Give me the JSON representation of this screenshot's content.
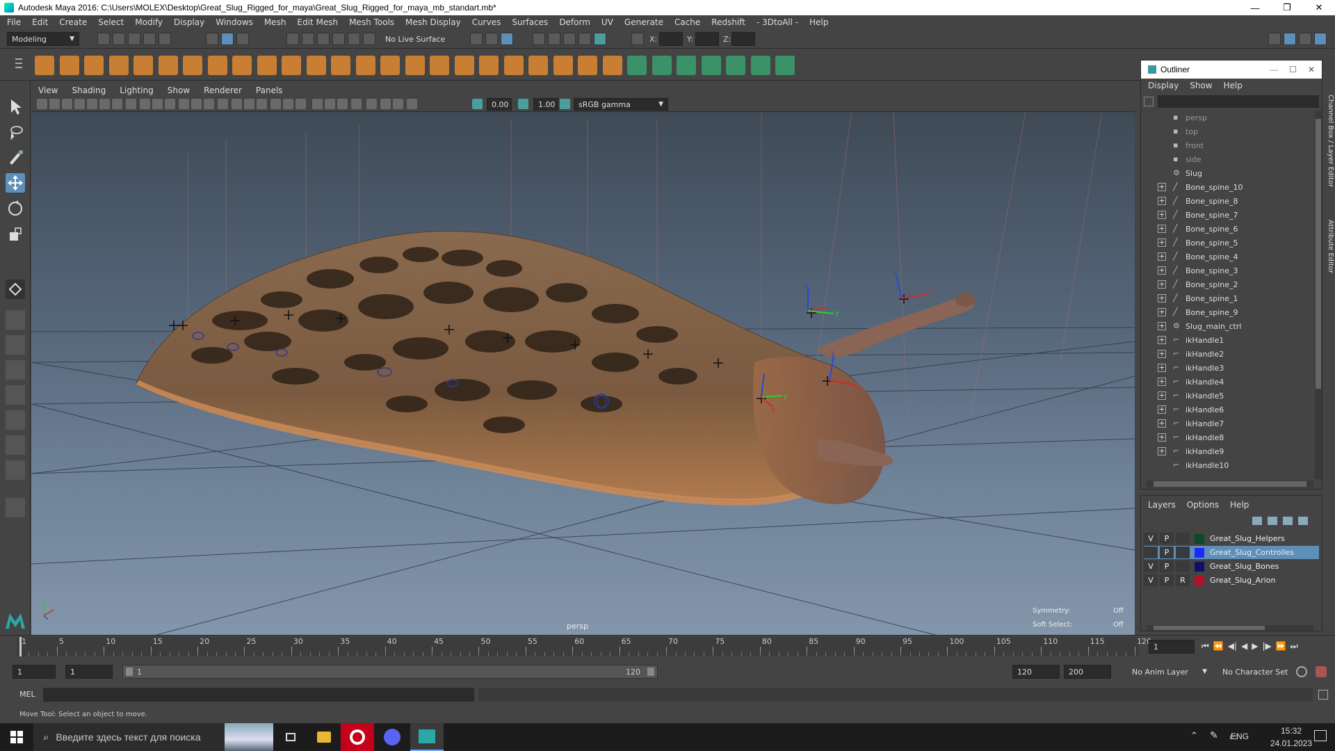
{
  "window": {
    "title": "Autodesk Maya 2016: C:\\Users\\MOLEX\\Desktop\\Great_Slug_Rigged_for_maya\\Great_Slug_Rigged_for_maya_mb_standart.mb*",
    "minimize": "—",
    "maximize": "❐",
    "close": "✕"
  },
  "menubar": [
    "File",
    "Edit",
    "Create",
    "Select",
    "Modify",
    "Display",
    "Windows",
    "Mesh",
    "Edit Mesh",
    "Mesh Tools",
    "Mesh Display",
    "Curves",
    "Surfaces",
    "Deform",
    "UV",
    "Generate",
    "Cache",
    "Redshift",
    "- 3DtoAll -",
    "Help"
  ],
  "statusline": {
    "mode": "Modeling",
    "live_surface": "No Live Surface",
    "x_label": "X:",
    "y_label": "Y:",
    "z_label": "Z:"
  },
  "viewport": {
    "menu": [
      "View",
      "Shading",
      "Lighting",
      "Show",
      "Renderer",
      "Panels"
    ],
    "exposure": "0.00",
    "gamma": "1.00",
    "color_space": "sRGB gamma",
    "camera_label": "persp",
    "symmetry_label": "Symmetry:",
    "symmetry_value": "Off",
    "soft_select_label": "Soft Select:",
    "soft_select_value": "Off"
  },
  "outliner": {
    "title": "Outliner",
    "menu": [
      "Display",
      "Show",
      "Help"
    ],
    "items": [
      {
        "label": "persp",
        "type": "camera",
        "expandable": false,
        "dim": true
      },
      {
        "label": "top",
        "type": "camera",
        "expandable": false,
        "dim": true
      },
      {
        "label": "front",
        "type": "camera",
        "expandable": false,
        "dim": true
      },
      {
        "label": "side",
        "type": "camera",
        "expandable": false,
        "dim": true
      },
      {
        "label": "Slug",
        "type": "group",
        "expandable": false,
        "dim": false
      },
      {
        "label": "Bone_spine_10",
        "type": "joint",
        "expandable": true,
        "dim": false
      },
      {
        "label": "Bone_spine_8",
        "type": "joint",
        "expandable": true,
        "dim": false
      },
      {
        "label": "Bone_spine_7",
        "type": "joint",
        "expandable": true,
        "dim": false
      },
      {
        "label": "Bone_spine_6",
        "type": "joint",
        "expandable": true,
        "dim": false
      },
      {
        "label": "Bone_spine_5",
        "type": "joint",
        "expandable": true,
        "dim": false
      },
      {
        "label": "Bone_spine_4",
        "type": "joint",
        "expandable": true,
        "dim": false
      },
      {
        "label": "Bone_spine_3",
        "type": "joint",
        "expandable": true,
        "dim": false
      },
      {
        "label": "Bone_spine_2",
        "type": "joint",
        "expandable": true,
        "dim": false
      },
      {
        "label": "Bone_spine_1",
        "type": "joint",
        "expandable": true,
        "dim": false
      },
      {
        "label": "Bone_spine_9",
        "type": "joint",
        "expandable": true,
        "dim": false
      },
      {
        "label": "Slug_main_ctrl",
        "type": "group",
        "expandable": true,
        "dim": false
      },
      {
        "label": "ikHandle1",
        "type": "ik",
        "expandable": true,
        "dim": false
      },
      {
        "label": "ikHandle2",
        "type": "ik",
        "expandable": true,
        "dim": false
      },
      {
        "label": "ikHandle3",
        "type": "ik",
        "expandable": true,
        "dim": false
      },
      {
        "label": "ikHandle4",
        "type": "ik",
        "expandable": true,
        "dim": false
      },
      {
        "label": "ikHandle5",
        "type": "ik",
        "expandable": true,
        "dim": false
      },
      {
        "label": "ikHandle6",
        "type": "ik",
        "expandable": true,
        "dim": false
      },
      {
        "label": "ikHandle7",
        "type": "ik",
        "expandable": true,
        "dim": false
      },
      {
        "label": "ikHandle8",
        "type": "ik",
        "expandable": true,
        "dim": false
      },
      {
        "label": "ikHandle9",
        "type": "ik",
        "expandable": true,
        "dim": false
      },
      {
        "label": "ikHandle10",
        "type": "ik",
        "expandable": false,
        "dim": false
      }
    ]
  },
  "layers": {
    "menu": [
      "Layers",
      "Options",
      "Help"
    ],
    "rows": [
      {
        "v": "V",
        "p": "P",
        "r": "",
        "name": "Great_Slug_Helpers",
        "color": "#0a4a2a",
        "selected": false
      },
      {
        "v": "",
        "p": "P",
        "r": "",
        "name": "Great_Slug_Controlles",
        "color": "#1a2aff",
        "selected": true
      },
      {
        "v": "V",
        "p": "P",
        "r": "",
        "name": "Great_Slug_Bones",
        "color": "#10106a",
        "selected": false
      },
      {
        "v": "V",
        "p": "P",
        "r": "R",
        "name": "Great_Slug_Arion",
        "color": "#b0102a",
        "selected": false
      }
    ]
  },
  "side_tabs": [
    "Channel Box / Layer Editor",
    "Attribute Editor"
  ],
  "timeline": {
    "ticks": [
      1,
      5,
      10,
      15,
      20,
      25,
      30,
      35,
      40,
      45,
      50,
      55,
      60,
      65,
      70,
      75,
      80,
      85,
      90,
      95,
      100,
      105,
      110,
      115,
      120
    ],
    "min": 1,
    "max": 120,
    "current_frame": "1"
  },
  "range": {
    "start": "1",
    "playback_start": "1",
    "slider_start": "1",
    "slider_end": "120",
    "playback_end": "120",
    "end": "200",
    "anim_layer": "No Anim Layer",
    "character_set": "No Character Set"
  },
  "cmdline": {
    "label": "MEL"
  },
  "helpline": {
    "text": "Move Tool: Select an object to move."
  },
  "taskbar": {
    "search_placeholder": "Введите здесь текст для поиска",
    "language": "ENG",
    "time": "15:32",
    "date": "24.01.2023"
  }
}
